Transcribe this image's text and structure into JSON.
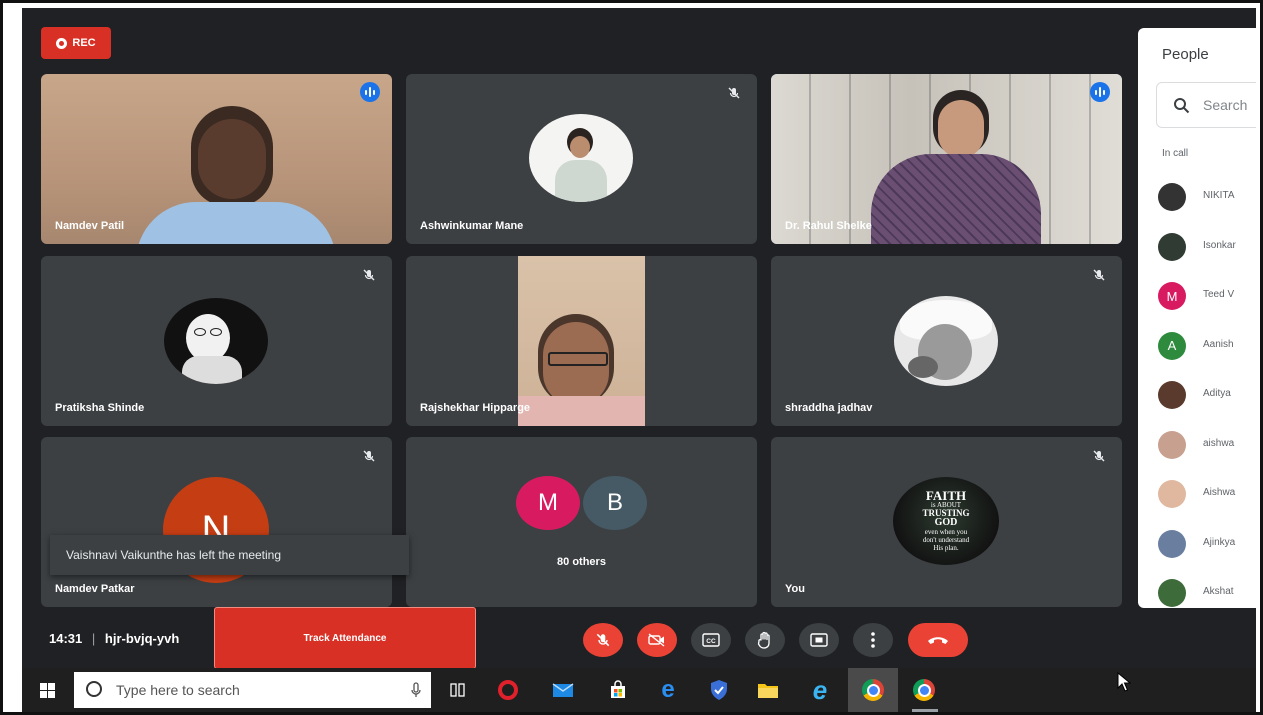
{
  "recording": {
    "label": "REC"
  },
  "tiles": [
    {
      "name": "Namdev Patil",
      "speaking": true
    },
    {
      "name": "Ashwinkumar Mane"
    },
    {
      "name": "Dr. Rahul Shelke",
      "speaking": true
    },
    {
      "name": "Pratiksha Shinde"
    },
    {
      "name": "Rajshekhar Hipparge"
    },
    {
      "name": "shraddha jadhav"
    },
    {
      "name": "Namdev Patkar",
      "initial": "N"
    },
    {
      "name": "80 others",
      "initials": [
        "M",
        "B"
      ]
    },
    {
      "name": "You"
    }
  ],
  "you_image_text": [
    "FAITH",
    "is ABOUT",
    "TRUSTING",
    "GOD",
    "even when you",
    "don't understand",
    "His plan."
  ],
  "notification": "Vaishnavi Vaikunthe has left the meeting",
  "people_panel": {
    "title": "People",
    "search_placeholder": "Search",
    "section": "In call",
    "participants": [
      {
        "name": "NIKITA",
        "initial": "",
        "color": "#333333"
      },
      {
        "name": "Isonkar",
        "initial": "",
        "color": "#2f3b33"
      },
      {
        "name": "Teed V",
        "initial": "M",
        "color": "#d81b60"
      },
      {
        "name": "Aanish",
        "initial": "A",
        "color": "#2e8b3e"
      },
      {
        "name": "Aditya",
        "initial": "",
        "color": "#5a3a2c"
      },
      {
        "name": "aishwa",
        "initial": "",
        "color": "#c8a090"
      },
      {
        "name": "Aishwa",
        "initial": "",
        "color": "#e0b8a0"
      },
      {
        "name": "Ajinkya",
        "initial": "",
        "color": "#6a7fa0"
      },
      {
        "name": "Akshat",
        "initial": "",
        "color": "#3d6b3a"
      }
    ]
  },
  "bottom_bar": {
    "time": "14:31",
    "meeting_code": "hjr-bvjq-yvh",
    "track_attendance": "Track Attendance"
  },
  "taskbar": {
    "search_placeholder": "Type here to search"
  }
}
